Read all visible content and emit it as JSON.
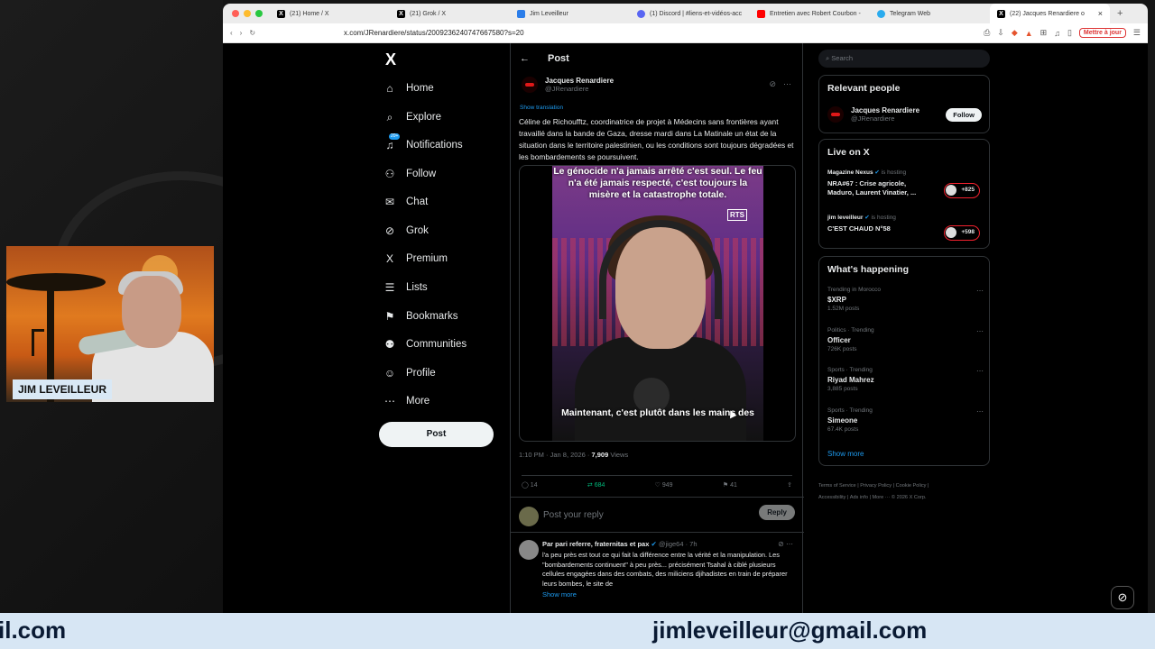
{
  "overlay": {
    "webcam_name": "JIM LEVEILLEUR",
    "lower_left_text": "il.com",
    "lower_right_text": "jimleveilleur@gmail.com"
  },
  "browser": {
    "tabs": [
      {
        "label": "(21) Home / X",
        "icon": "x-icon"
      },
      {
        "label": "(21) Grok / X",
        "icon": "x-icon"
      },
      {
        "label": "Jim Leveilleur",
        "icon": "doc-icon"
      },
      {
        "label": "(1) Discord | #liens-et-vidéos-acc",
        "icon": "discord-icon"
      },
      {
        "label": "Entretien avec Robert Courbon -",
        "icon": "youtube-icon"
      },
      {
        "label": "Telegram Web",
        "icon": "telegram-icon"
      },
      {
        "label": "(22) Jacques Renardiere o",
        "icon": "x-icon",
        "active": true
      }
    ],
    "url": "x.com/JRenardiere/status/2009236240747667580?s=20",
    "update_button": "Mettre à jour"
  },
  "nav": {
    "items": [
      {
        "label": "Home",
        "icon": "home-icon",
        "glyph": "⌂"
      },
      {
        "label": "Explore",
        "icon": "search-icon",
        "glyph": "⌕"
      },
      {
        "label": "Notifications",
        "icon": "bell-icon",
        "glyph": "♫",
        "badge": "20+"
      },
      {
        "label": "Follow",
        "icon": "add-person-icon",
        "glyph": "⚇"
      },
      {
        "label": "Chat",
        "icon": "chat-icon",
        "glyph": "✉"
      },
      {
        "label": "Grok",
        "icon": "grok-icon",
        "glyph": "⊘"
      },
      {
        "label": "Premium",
        "icon": "x-icon",
        "glyph": "X"
      },
      {
        "label": "Lists",
        "icon": "list-icon",
        "glyph": "☰"
      },
      {
        "label": "Bookmarks",
        "icon": "bookmark-icon",
        "glyph": "⚑"
      },
      {
        "label": "Communities",
        "icon": "communities-icon",
        "glyph": "⚉"
      },
      {
        "label": "Profile",
        "icon": "profile-icon",
        "glyph": "☺"
      },
      {
        "label": "More",
        "icon": "more-icon",
        "glyph": "⋯"
      }
    ],
    "post_button": "Post"
  },
  "post": {
    "header": "Post",
    "author_name": "Jacques Renardiere",
    "author_handle": "@JRenardiere",
    "show_translation": "Show translation",
    "text": "Céline de Richoufftz, coordinatrice de projet à Médecins sans frontières ayant travaillé dans la bande de Gaza, dresse mardi dans La Matinale un état de la situation dans le  territoire palestinien, ou les conditions sont toujours dégradées et les  bombardements se poursuivent.",
    "video_caption_top": "Le génocide n'a jamais arrêté c'est seul. Le feu n'a été jamais respecté, c'est toujours la misère et la catastrophe totale.",
    "video_logo": "RTS",
    "video_caption_bottom": "Maintenant, c'est plutôt dans les mains des",
    "time": "1:10 PM · Jan 8, 2026 · ",
    "views_count": "7,909",
    "views_label": " Views",
    "replies": "14",
    "reposts": "684",
    "likes": "949",
    "bookmarks": "41",
    "reply_placeholder": "Post your reply",
    "reply_button": "Reply"
  },
  "comment": {
    "name": "Par pari referre, fraternitas et pax",
    "handle_time": "@jige64 · 7h",
    "text": "l'a peu près est tout ce qui fait la différence entre la vérité et la manipulation. Les \"bombardements continuent\" à peu près... précisément Tsahal à ciblé plusieurs cellules engagées dans des combats, des miliciens djihadistes en train de préparer leurs bombes, le site de",
    "show_more": "Show more"
  },
  "sidebar": {
    "search_placeholder": "Search",
    "relevant_title": "Relevant people",
    "relevant_name": "Jacques Renardiere",
    "relevant_handle": "@JRenardiere",
    "follow_button": "Follow",
    "live_title": "Live on X",
    "live": [
      {
        "host": "Magazine Nexus",
        "suffix": " is hosting",
        "title": "NRA#67 : Crise agricole, Maduro, Laurent Vinatier, ...",
        "count": "+825"
      },
      {
        "host": "jim leveilleur",
        "suffix": " is hosting",
        "title": "C'EST CHAUD N°58",
        "count": "+598"
      }
    ],
    "happening_title": "What's happening",
    "trends": [
      {
        "context": "Trending in Morocco",
        "name": "$XRP",
        "posts": "1.52M posts"
      },
      {
        "context": "Politics · Trending",
        "name": "Officer",
        "posts": "726K posts"
      },
      {
        "context": "Sports · Trending",
        "name": "Riyad Mahrez",
        "posts": "3,885 posts"
      },
      {
        "context": "Sports · Trending",
        "name": "Simeone",
        "posts": "67.4K posts"
      }
    ],
    "show_more": "Show more",
    "footer_line1": "Terms of Service  |  Privacy Policy  |  Cookie Policy  |",
    "footer_line2": "Accessibility  |  Ads info  |  More ···  © 2026 X Corp."
  }
}
